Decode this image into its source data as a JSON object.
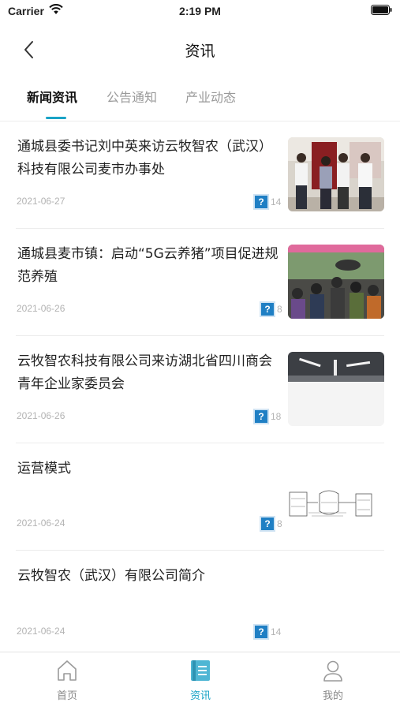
{
  "status_bar": {
    "carrier": "Carrier",
    "time": "2:19 PM"
  },
  "nav": {
    "title": "资讯"
  },
  "tabs": [
    {
      "label": "新闻资讯",
      "active": true
    },
    {
      "label": "公告通知",
      "active": false
    },
    {
      "label": "产业动态",
      "active": false
    }
  ],
  "news": [
    {
      "title": "通城县委书记刘中英来访云牧智农（武汉）科技有限公司麦市办事处",
      "date": "2021-06-27",
      "count": "14",
      "help": "?"
    },
    {
      "title": "通城县麦市镇：启动“5G云养猪”项目促进规范养殖",
      "date": "2021-06-26",
      "count": "8",
      "help": "?"
    },
    {
      "title": "云牧智农科技有限公司来访湖北省四川商会青年企业家委员会",
      "date": "2021-06-26",
      "count": "18",
      "help": "?"
    },
    {
      "title": "运营模式",
      "date": "2021-06-24",
      "count": "8",
      "help": "?"
    },
    {
      "title": "云牧智农（武汉）有限公司简介",
      "date": "2021-06-24",
      "count": "14",
      "help": "?"
    }
  ],
  "tab_bar": [
    {
      "label": "首页",
      "icon": "home-icon",
      "active": false
    },
    {
      "label": "资讯",
      "icon": "news-icon",
      "active": true
    },
    {
      "label": "我的",
      "icon": "profile-icon",
      "active": false
    }
  ],
  "colors": {
    "accent": "#1aa3c6",
    "help_icon": "#1f7fc4"
  }
}
